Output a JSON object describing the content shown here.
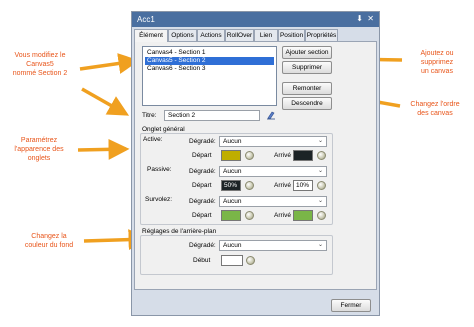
{
  "window": {
    "title": "Acc1",
    "pin_glyph": "⬇",
    "close_glyph": "✕"
  },
  "tabs": [
    {
      "label": "Élément",
      "active": true
    },
    {
      "label": "Options"
    },
    {
      "label": "Actions"
    },
    {
      "label": "RollOver"
    },
    {
      "label": "Lien"
    },
    {
      "label": "Position"
    },
    {
      "label": "Propriétés"
    }
  ],
  "sections_list": [
    {
      "label": "Canvas4 - Section 1",
      "selected": false
    },
    {
      "label": "Canvas5 - Section 2",
      "selected": true
    },
    {
      "label": "Canvas6 - Section 3",
      "selected": false
    }
  ],
  "buttons": {
    "add": "Ajouter section",
    "delete": "Supprimer",
    "up": "Remonter",
    "down": "Descendre",
    "close": "Fermer"
  },
  "title_field": {
    "label": "Titre:",
    "value": "Section 2"
  },
  "onglet": {
    "heading": "Onglet général",
    "active": {
      "label": "Active:",
      "gradient_label": "Dégradé:",
      "gradient_value": "Aucun",
      "start_label": "Départ",
      "start_color": "#bfae00",
      "end_label": "Arrivé",
      "end_color": "#1c2326"
    },
    "passive": {
      "label": "Passive:",
      "gradient_label": "Dégradé:",
      "gradient_value": "Aucun",
      "start_label": "Départ",
      "start_value": "50%",
      "start_color": "#1c2326",
      "end_label": "Arrivé",
      "end_value": "10%",
      "end_color": "#ffffff"
    },
    "hover": {
      "label": "Survolez:",
      "gradient_label": "Dégradé:",
      "gradient_value": "Aucun",
      "start_label": "Départ",
      "start_color": "#7ab648",
      "end_label": "Arrivé",
      "end_color": "#7ab648"
    }
  },
  "background": {
    "heading": "Réglages de l'arrière-plan",
    "gradient_label": "Dégradé:",
    "gradient_value": "Aucun",
    "start_label": "Début",
    "start_color": "#ffffff"
  },
  "callouts": {
    "modify": [
      "Vous modifiez le",
      "Canvas5",
      "nommé Section 2"
    ],
    "add_remove": [
      "Ajoutez ou",
      "supprimez",
      "un canvas"
    ],
    "order": [
      "Changez l'ordre",
      "des canvas"
    ],
    "tabs_appearance": [
      "Paramétrez",
      "l'apparence des",
      "onglets"
    ],
    "bg_color": [
      "Changez la",
      "couleur du fond"
    ]
  },
  "colors": {
    "accent_orange": "#e8551a",
    "titlebar": "#4a6fa0",
    "selection": "#2f6fd6"
  }
}
